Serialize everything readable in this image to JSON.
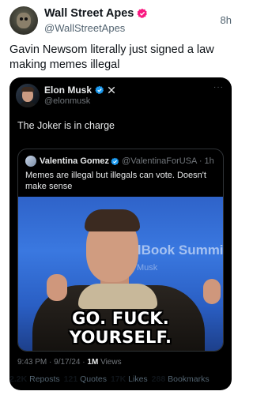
{
  "post": {
    "author_name": "Wall Street Apes",
    "author_handle": "@WallStreetApes",
    "time": "8h",
    "text": "Gavin Newsom literally just signed a law making memes illegal"
  },
  "embedded": {
    "author_name": "Elon Musk",
    "author_handle": "@elonmusk",
    "more": "···",
    "text": "The Joker is in charge",
    "quote": {
      "author_name": "Valentina Gomez",
      "author_handle": "@ValentinaForUSA · 1h",
      "text": "Memes are illegal but illegals can vote. Doesn't make sense"
    },
    "image": {
      "background_text_1": "ealBook Summit",
      "background_text_2": "Musk",
      "meme_caption": "GO. FUCK. YOURSELF."
    },
    "meta": {
      "time_date": "9:43 PM · 9/17/24 · ",
      "views_count": "1M",
      "views_label": " Views"
    }
  },
  "stats": [
    {
      "count": "2.2K",
      "label": "Reposts"
    },
    {
      "count": "121",
      "label": "Quotes"
    },
    {
      "count": "17K",
      "label": "Likes"
    },
    {
      "count": "288",
      "label": "Bookmarks"
    }
  ],
  "colors": {
    "verified_blue": "#1d9bf0",
    "verified_pink": "#f91880",
    "card_background": "#000000",
    "secondary_text": "#536471"
  },
  "icons": [
    "verified-badge-icon",
    "x-logo-icon"
  ]
}
